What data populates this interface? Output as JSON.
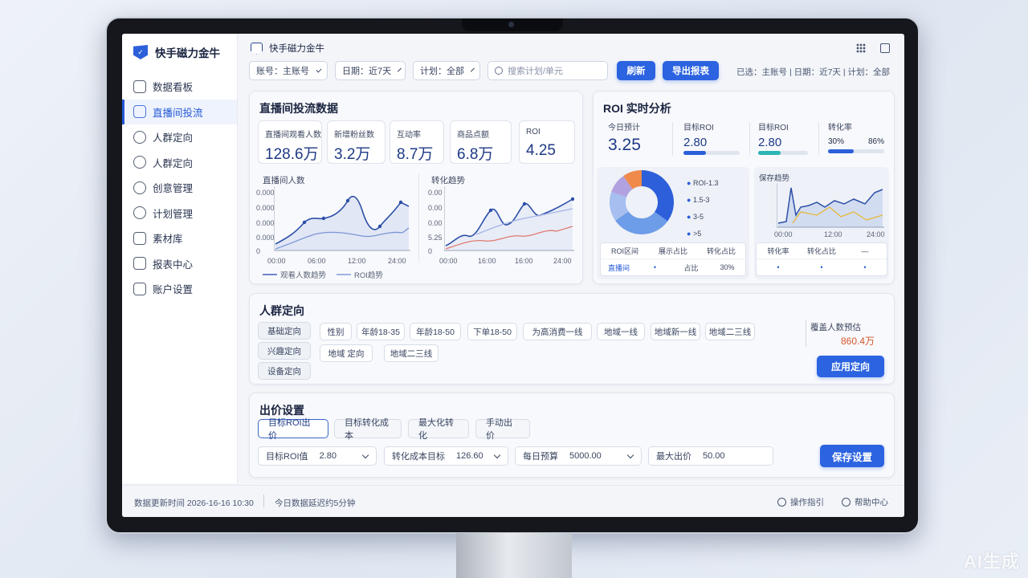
{
  "app": {
    "title": "快手磁力金牛",
    "topbar_title": "快手磁力金牛"
  },
  "sidebar": {
    "items": [
      {
        "label": "数据看板",
        "icon": "dashboard-icon"
      },
      {
        "label": "直播间投流",
        "icon": "live-icon",
        "active": true
      },
      {
        "label": "人群定向",
        "icon": "audience-icon"
      },
      {
        "label": "人群定向",
        "icon": "target-icon"
      },
      {
        "label": "创意管理",
        "icon": "creative-icon"
      },
      {
        "label": "计划管理",
        "icon": "plan-icon"
      },
      {
        "label": "素材库",
        "icon": "library-icon"
      },
      {
        "label": "报表中心",
        "icon": "report-icon"
      },
      {
        "label": "账户设置",
        "icon": "account-icon"
      }
    ]
  },
  "filters": {
    "account": "账号：主账号",
    "date": "日期：近7天",
    "plan": "计划：全部",
    "search_placeholder": "搜索计划/单元",
    "refresh": "刷新",
    "export": "导出报表",
    "selected_info": "已选：主账号 | 日期：近7天 | 计划：全部"
  },
  "live": {
    "title": "直播间投流数据",
    "kpis": [
      {
        "label": "直播间观看人数",
        "value": "128.6万"
      },
      {
        "label": "新增粉丝数",
        "value": "3.2万"
      },
      {
        "label": "互动率",
        "value": "8.7万"
      },
      {
        "label": "商品点额",
        "value": "6.8万"
      },
      {
        "label": "ROI",
        "value": "4.25"
      }
    ],
    "chart1": {
      "label": "直播间人数",
      "y_ticks": [
        "0.000",
        "0.000",
        "0.000",
        "0.000",
        "0.000",
        "0"
      ],
      "x_ticks": [
        "00:00",
        "06:00",
        "12:00",
        "24:00"
      ],
      "legend": [
        "观看人数趋势",
        "ROI趋势"
      ]
    },
    "chart2": {
      "label": "转化趋势",
      "y_ticks": [
        "0.00",
        "0.00",
        "0.00",
        "0.00",
        "5.25",
        "0"
      ],
      "x_ticks": [
        "00:00",
        "16:00",
        "16:00",
        "24:00"
      ]
    }
  },
  "roi": {
    "title": "ROI 实时分析",
    "items": [
      {
        "label": "今日预计",
        "value": "3.25"
      },
      {
        "label": "目标ROI",
        "value": "2.80"
      },
      {
        "label": "目标ROI",
        "value": "2.80"
      },
      {
        "label": "转化率",
        "value_a": "30%",
        "value_b": "86%"
      }
    ],
    "pie_legend": [
      "ROI-1.3",
      "1.5-3",
      "3-5",
      ">5"
    ],
    "pie_table": {
      "headers": [
        "ROI区间",
        "展示占比",
        "转化占比"
      ],
      "row": [
        "直播间",
        "•",
        "占比",
        "30%"
      ]
    },
    "trend_label": "保存趋势",
    "trend_x": [
      "00:00",
      "12:00",
      "24:00"
    ],
    "trend_table": {
      "headers": [
        "转化率",
        "转化占比",
        "—"
      ],
      "row": [
        "•",
        "•",
        "•"
      ]
    }
  },
  "audience": {
    "title": "人群定向",
    "groups": [
      "基础定向",
      "兴趣定向",
      "设备定向"
    ],
    "tags": [
      "性别",
      "年龄18-35",
      "年龄18-50",
      "下单18-50",
      "为高消费一线",
      "地域一线",
      "地域新一线",
      "地域二三线",
      "地域 定向",
      "地域二三线"
    ],
    "coverage_label": "覆盖人数预估",
    "coverage_value": "860.4万",
    "apply": "应用定向"
  },
  "bid": {
    "title": "出价设置",
    "tabs": [
      "目标ROI出价",
      "目标转化成本",
      "最大化转化",
      "手动出价"
    ],
    "fields": [
      {
        "label": "目标ROI值",
        "value": "2.80"
      },
      {
        "label": "转化成本目标",
        "value": "126.60"
      },
      {
        "label": "每日预算",
        "value": "5000.00"
      },
      {
        "label": "最大出价",
        "value": "50.00"
      }
    ],
    "save": "保存设置"
  },
  "footer": {
    "update_time": "数据更新时间 2026-16-16 10:30",
    "delay": "今日数据延迟约5分钟",
    "guide": "操作指引",
    "help": "帮助中心"
  },
  "watermark": "AI生成",
  "colors": {
    "accent": "#2c63e0",
    "kpi_value": "#1e3a86",
    "coverage": "#d4572a"
  }
}
